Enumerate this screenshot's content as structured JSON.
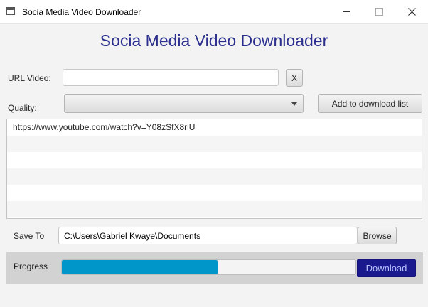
{
  "window": {
    "title": "Socia Media Video Downloader"
  },
  "header": {
    "title": "Socia Media Video Downloader"
  },
  "url": {
    "label": "URL Video:",
    "value": "",
    "clear_label": "X"
  },
  "quality": {
    "label": "Quality:",
    "selected": ""
  },
  "add_button_label": "Add to download list",
  "download_list": {
    "items": [
      "https://www.youtube.com/watch?v=Y08zSfX8riU",
      "",
      "",
      "",
      "",
      ""
    ]
  },
  "save_to": {
    "label": "Save To",
    "value": "C:\\Users\\Gabriel Kwaye\\Documents",
    "browse_label": "Browse"
  },
  "progress": {
    "label": "Progress",
    "fraction": 0.53,
    "download_label": "Download"
  },
  "colors": {
    "accent": "#2b2f8e",
    "progress_fill": "#0096c9",
    "download_button": "#1a1a8e"
  }
}
